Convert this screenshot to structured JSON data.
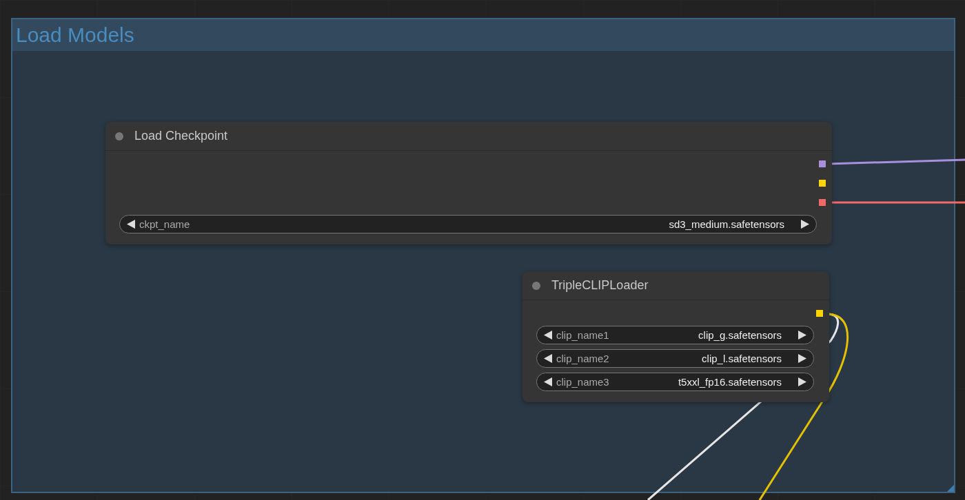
{
  "group": {
    "title": "Load Models"
  },
  "nodes": [
    {
      "title": "Load Checkpoint",
      "outputs": [
        {
          "color": "#a98fdb"
        },
        {
          "color": "#ffd500"
        },
        {
          "color": "#f06868"
        }
      ],
      "widgets": [
        {
          "name": "ckpt_name",
          "value": "sd3_medium.safetensors"
        }
      ]
    },
    {
      "title": "TripleCLIPLoader",
      "outputs": [
        {
          "color": "#ffd500"
        }
      ],
      "widgets": [
        {
          "name": "clip_name1",
          "value": "clip_g.safetensors"
        },
        {
          "name": "clip_name2",
          "value": "clip_l.safetensors"
        },
        {
          "name": "clip_name3",
          "value": "t5xxl_fp16.safetensors"
        }
      ]
    }
  ]
}
